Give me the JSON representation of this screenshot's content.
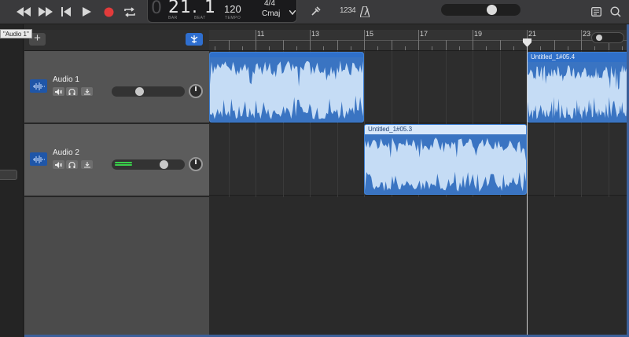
{
  "transport": {
    "position_dim": "0",
    "position": "21. 1",
    "bar_label": "BAR",
    "beat_label": "BEAT",
    "tempo": "120",
    "tempo_label": "TEMPO",
    "time_signature": "4/4",
    "key": "Cmaj",
    "count_in": "1234",
    "master_volume": 0.67
  },
  "tooltip": "\"Audio 1\"",
  "header": {
    "add_track_label": "+"
  },
  "ruler": {
    "bars": [
      "11",
      "13",
      "15",
      "17",
      "19",
      "21",
      "23"
    ]
  },
  "tracks": [
    {
      "name": "Audio 1",
      "volume": 0.36,
      "meter_active": false
    },
    {
      "name": "Audio 2",
      "volume": 0.76,
      "meter_active": true
    }
  ],
  "regions": [
    {
      "track": 1,
      "title": "",
      "start_bar": 9.0,
      "end_bar": 15.0,
      "selected": false
    },
    {
      "track": 2,
      "title": "Untitled_1#05.3",
      "start_bar": 15.0,
      "end_bar": 21.0,
      "selected": true
    },
    {
      "track": 1,
      "title": "Untitled_1#05.4",
      "start_bar": 21.0,
      "end_bar": 25.0,
      "selected": false
    }
  ],
  "playhead_bar": 21.0,
  "colors": {
    "region_fill": "#c5dcf5",
    "region_wave": "#3a74c2",
    "region_title": "#2f6fc8",
    "record": "#e23b3b",
    "smart_controls": "#2f6fd0",
    "meter_green": "#39d04a"
  }
}
